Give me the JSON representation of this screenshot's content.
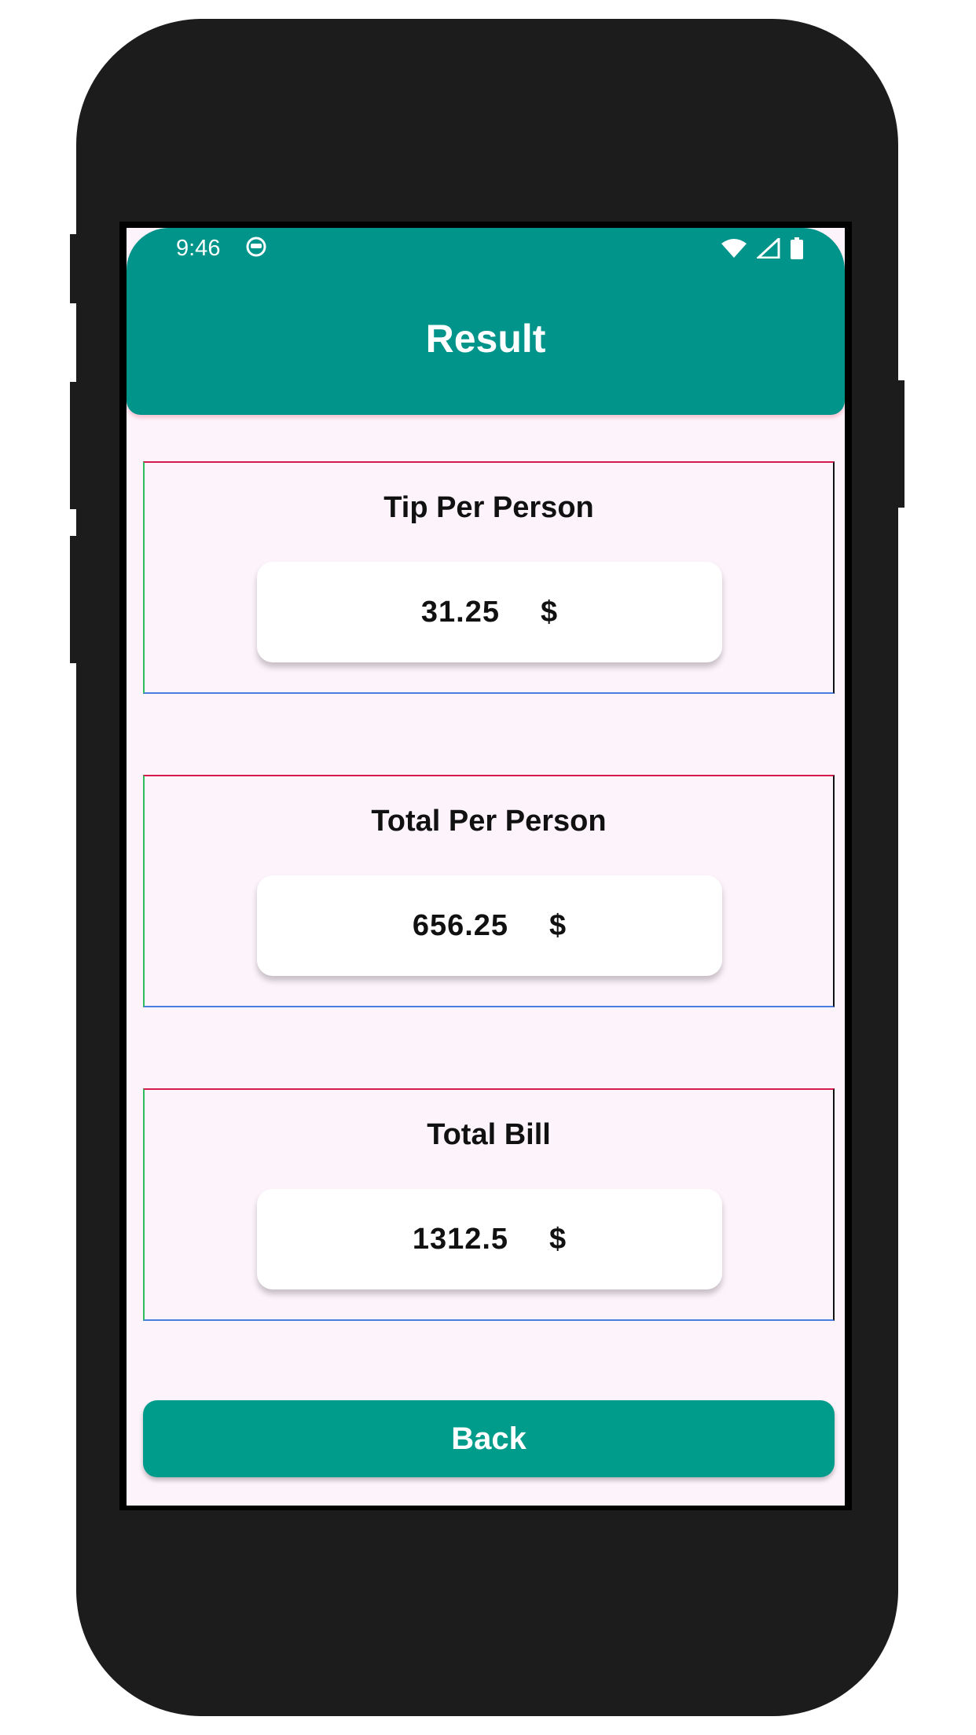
{
  "status_bar": {
    "time": "9:46",
    "icons": [
      "face-icon",
      "wifi-icon",
      "cellular-signal-icon",
      "battery-icon"
    ]
  },
  "app_bar": {
    "title": "Result",
    "color": "#00948a"
  },
  "cards": [
    {
      "title": "Tip Per Person",
      "value": "31.25",
      "currency": "$"
    },
    {
      "title": "Total Per Person",
      "value": "656.25",
      "currency": "$"
    },
    {
      "title": "Total Bill",
      "value": "1312.5",
      "currency": "$"
    }
  ],
  "back_button": {
    "label": "Back",
    "color": "#009c8b"
  },
  "colors": {
    "screen_background": "#fdf3fb",
    "phone_frame": "#1c1c1c"
  }
}
